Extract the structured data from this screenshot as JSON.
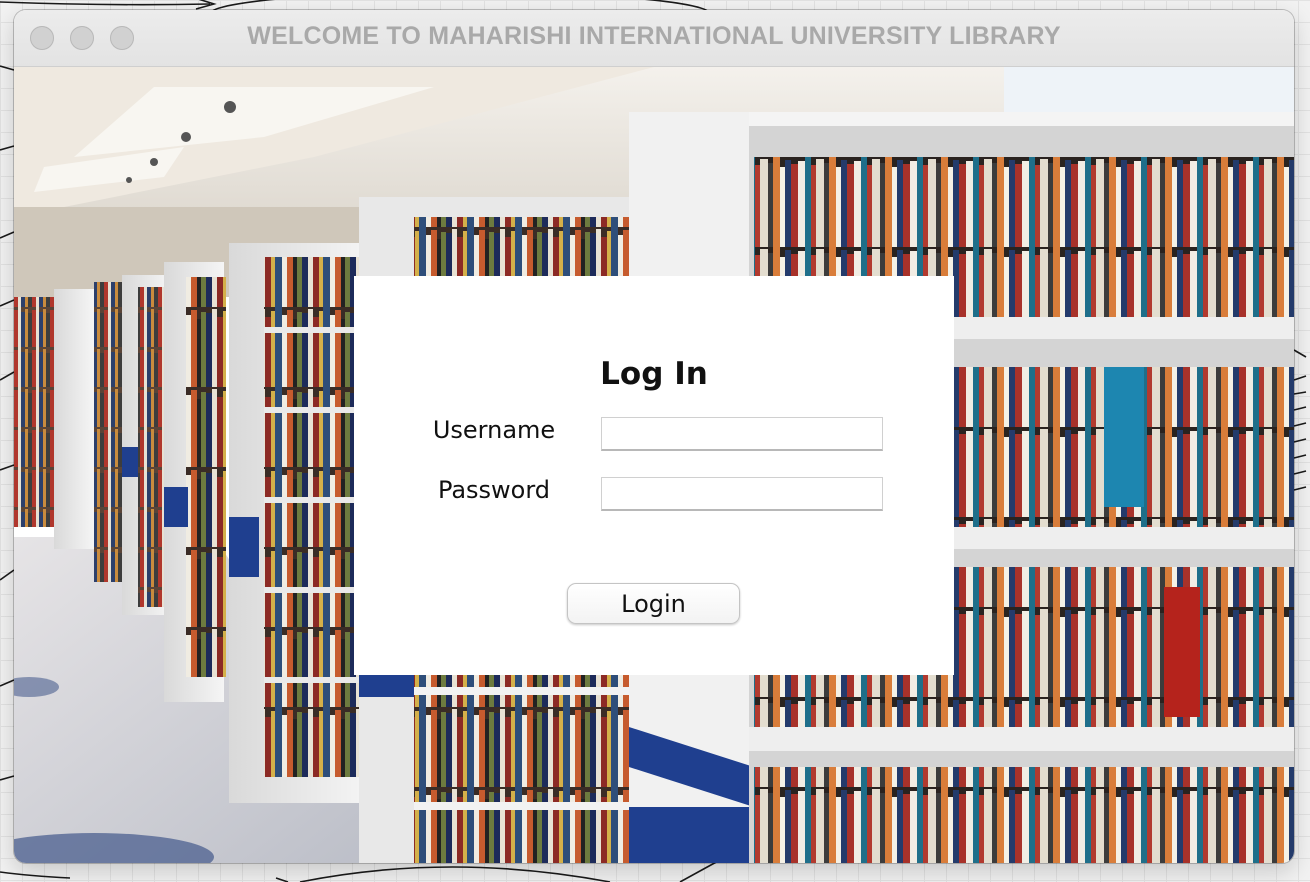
{
  "window": {
    "title": "WELCOME TO MAHARISHI INTERNATIONAL UNIVERSITY LIBRARY",
    "controls": [
      "close",
      "minimize",
      "zoom"
    ]
  },
  "background": {
    "description_icon": "library-bookshelves-photo"
  },
  "login": {
    "heading": "Log In",
    "username_label": "Username",
    "username_value": "",
    "password_label": "Password",
    "password_value": "",
    "button_label": "Login"
  },
  "colors": {
    "title_text": "#a9a9a9",
    "panel": "#ffffff",
    "accent_blue": "#1f3f8f"
  }
}
